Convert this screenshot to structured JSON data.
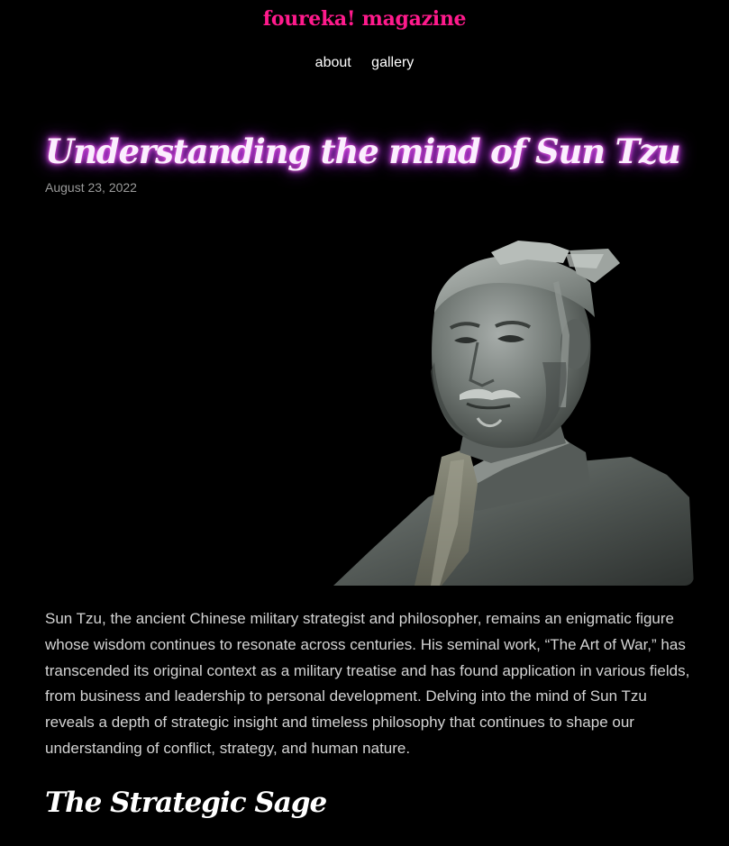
{
  "site": {
    "title": "foureka! magazine"
  },
  "nav": {
    "items": [
      "about",
      "gallery"
    ]
  },
  "post": {
    "title": "Understanding the mind of Sun Tzu",
    "date": "August 23, 2022",
    "intro": "Sun Tzu, the ancient Chinese military strategist and philosopher, remains an enigmatic figure whose wisdom continues to resonate across centuries. His seminal work, “The Art of War,” has transcended its original context as a military treatise and has found application in various fields, from business and leadership to personal development. Delving into the mind of Sun Tzu reveals a depth of strategic insight and timeless philosophy that continues to shape our understanding of conflict, strategy, and human nature.",
    "section_heading": "The Strategic Sage"
  },
  "colors": {
    "background": "#000000",
    "site_title": "#ff1a8c",
    "title_glow": "#d23cff",
    "body_text": "#d4d4d4",
    "date_text": "#9a9a9a"
  },
  "icons": {
    "hero_image": "terracotta-warrior-bust"
  }
}
